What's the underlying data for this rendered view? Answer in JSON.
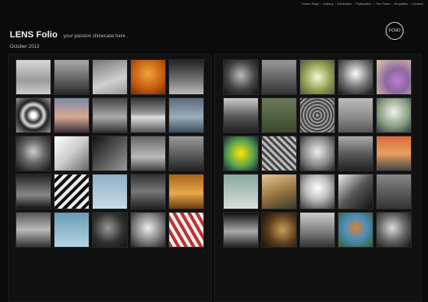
{
  "nav": {
    "items": [
      "Home Page",
      "Gallery",
      "Exhibition",
      "Publication",
      "The Team",
      "Enquiries",
      "Contact"
    ]
  },
  "site": {
    "title": "LENS Folio",
    "tagline": ". your passion showcase here .",
    "logo_text": "FOliO",
    "date": "October 2013"
  },
  "gallery_left": [
    {
      "icon": "birds-photo",
      "bg": "linear-gradient(180deg,#d9d9d9,#9a9a9a 60%,#cfcfcf)"
    },
    {
      "icon": "rock-sea-photo",
      "bg": "linear-gradient(180deg,#aaa,#666 55%,#2a2a2a)"
    },
    {
      "icon": "pier-photo",
      "bg": "linear-gradient(160deg,#777,#cfcfcf 60%,#999)"
    },
    {
      "icon": "tree-orange-photo",
      "bg": "radial-gradient(circle at 50% 40%,#f4a23a,#c25a10 60%,#7a2a00)"
    },
    {
      "icon": "coast-photo",
      "bg": "linear-gradient(180deg,#222,#777 60%,#bbb)"
    },
    {
      "icon": "spiral-photo",
      "bg": "radial-gradient(circle,#fff 10%,#333 30%,#ddd 45%,#222 60%,#999)"
    },
    {
      "icon": "sunset-lake-photo",
      "bg": "linear-gradient(180deg,#7a8aa8,#d8a890 55%,#3a3040)"
    },
    {
      "icon": "fog-trees-photo",
      "bg": "linear-gradient(180deg,#444,#aaa 55%,#333)"
    },
    {
      "icon": "storm-sea-photo",
      "bg": "linear-gradient(180deg,#333,#999 45%,#ddd 55%,#555)"
    },
    {
      "icon": "blue-shore-photo",
      "bg": "linear-gradient(180deg,#5a6a7a,#9aaebc 55%,#3d4d5c)"
    },
    {
      "icon": "girl-portrait-photo",
      "bg": "radial-gradient(circle at 50% 45%,#cfcfcf,#666 45%,#111)"
    },
    {
      "icon": "white-curve-photo",
      "bg": "linear-gradient(135deg,#fff,#ccc 50%,#666)"
    },
    {
      "icon": "dark-dunes-photo",
      "bg": "linear-gradient(135deg,#111,#555 50%,#999)"
    },
    {
      "icon": "lighthouse-photo",
      "bg": "linear-gradient(180deg,#666,#bbb 60%,#444)"
    },
    {
      "icon": "hills-photo",
      "bg": "linear-gradient(180deg,#999,#555 60%,#222)"
    },
    {
      "icon": "city-night-photo",
      "bg": "linear-gradient(180deg,#222,#888 60%,#111)"
    },
    {
      "icon": "stripes-photo",
      "bg": "repeating-linear-gradient(135deg,#eee 0 4px,#111 4px 8px)"
    },
    {
      "icon": "stork-photo",
      "bg": "linear-gradient(180deg,#8fb0c8,#c7dbe8)"
    },
    {
      "icon": "dark-window-photo",
      "bg": "linear-gradient(180deg,#333,#777 50%,#222)"
    },
    {
      "icon": "gold-sea-photo",
      "bg": "linear-gradient(180deg,#a8641a,#e7a94a 55%,#6b3b0e)"
    },
    {
      "icon": "bay-photo",
      "bg": "linear-gradient(180deg,#555,#bbb 50%,#333)"
    },
    {
      "icon": "white-bird-photo",
      "bg": "linear-gradient(180deg,#6a9bb5,#b5d5e6)"
    },
    {
      "icon": "hand-portrait-photo",
      "bg": "radial-gradient(circle at 45% 45%,#999,#333 55%,#111)"
    },
    {
      "icon": "headwrap-portrait-photo",
      "bg": "radial-gradient(circle at 50% 45%,#eee,#888 50%,#222)"
    },
    {
      "icon": "red-building-photo",
      "bg": "repeating-linear-gradient(60deg,#b33 0 4px,#eee 4px 8px)"
    }
  ],
  "gallery_right": [
    {
      "icon": "old-man-photo",
      "bg": "radial-gradient(circle at 50% 45%,#bbb,#444 55%,#111)"
    },
    {
      "icon": "couple-photo",
      "bg": "linear-gradient(180deg,#999,#333)"
    },
    {
      "icon": "tower-photo",
      "bg": "radial-gradient(circle,#f7f7d0,#8a9a4a 60%,#555)"
    },
    {
      "icon": "bright-sky-photo",
      "bg": "radial-gradient(circle at 50% 40%,#fff,#777 50%,#111)"
    },
    {
      "icon": "thistle-photo",
      "bg": "radial-gradient(circle at 60% 60%,#c07ad8,#8a6aa0 40%,#e8c8a8)"
    },
    {
      "icon": "mono-dock-photo",
      "bg": "linear-gradient(180deg,#ccc,#555 55%,#222)"
    },
    {
      "icon": "tree-field-photo",
      "bg": "linear-gradient(180deg,#6a7a5a,#3a4a2a)"
    },
    {
      "icon": "crowd-photo",
      "bg": "repeating-radial-gradient(circle,#999 0 2px,#444 2px 4px)"
    },
    {
      "icon": "winter-bench-photo",
      "bg": "linear-gradient(180deg,#bbb,#888 60%,#555)"
    },
    {
      "icon": "dandelion-photo",
      "bg": "radial-gradient(circle at 50% 40%,#f0f0f0,#8aa080 55%,#334)"
    },
    {
      "icon": "neon-green-photo",
      "bg": "radial-gradient(circle,#ffe800,#5aa050 55%,#123)"
    },
    {
      "icon": "glass-roof-photo",
      "bg": "repeating-linear-gradient(45deg,#bbb 0 3px,#444 3px 6px)"
    },
    {
      "icon": "blonde-portrait-photo",
      "bg": "radial-gradient(circle at 50% 45%,#eee,#888 55%,#222)"
    },
    {
      "icon": "machine-photo",
      "bg": "linear-gradient(180deg,#aaa,#555 55%,#222)"
    },
    {
      "icon": "red-bridge-photo",
      "bg": "linear-gradient(180deg,#d86a3a,#e8a060 50%,#444)"
    },
    {
      "icon": "tern-photo",
      "bg": "linear-gradient(180deg,#8aa8a0,#d8e0d8)"
    },
    {
      "icon": "sand-shore-photo",
      "bg": "linear-gradient(160deg,#e8c890,#8a6a3a 60%,#3a3a30)"
    },
    {
      "icon": "woman-face-photo",
      "bg": "radial-gradient(circle at 50% 40%,#fff,#bbb 45%,#333)"
    },
    {
      "icon": "diagonal-wall-photo",
      "bg": "linear-gradient(135deg,#eee,#555 50%,#111)"
    },
    {
      "icon": "chain-photo",
      "bg": "linear-gradient(180deg,#888,#333)"
    },
    {
      "icon": "clouds-photo",
      "bg": "linear-gradient(180deg,#111,#aaa 55%,#222)"
    },
    {
      "icon": "saxophone-photo",
      "bg": "radial-gradient(circle at 60% 50%,#c8a05a,#5a3a1a 55%,#111)"
    },
    {
      "icon": "bridge-ruins-photo",
      "bg": "linear-gradient(180deg,#ccc,#777 60%,#333)"
    },
    {
      "icon": "kingfisher-photo",
      "bg": "radial-gradient(circle at 50% 45%,#e08030,#4a90c0 45%,#3a5a2a)"
    },
    {
      "icon": "eagle-photo",
      "bg": "radial-gradient(circle at 45% 45%,#ddd,#666 50%,#111)"
    }
  ]
}
